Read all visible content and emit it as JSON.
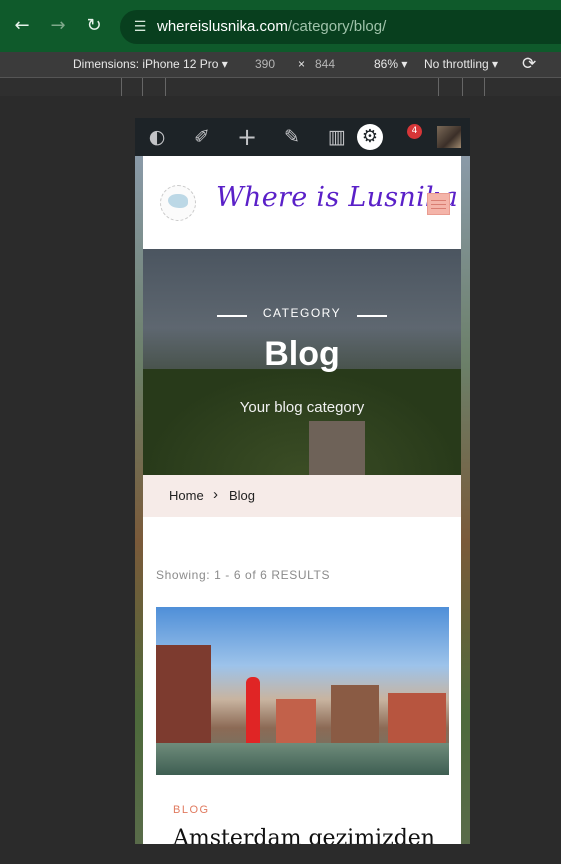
{
  "browser": {
    "url_domain": "whereislusnika.com",
    "url_path": "/category/blog/",
    "back_icon": "arrow-left-icon",
    "forward_icon": "arrow-right-icon",
    "reload_icon": "reload-icon",
    "site_settings_icon": "tune-icon"
  },
  "devtools": {
    "dimensions_label": "Dimensions: iPhone 12 Pro",
    "width": "390",
    "times": "×",
    "height": "844",
    "zoom": "86%",
    "throttling": "No throttling",
    "rotate_icon": "rotate-icon"
  },
  "admin_bar": {
    "icons": [
      "dashboard-icon",
      "customize-icon",
      "add-new-icon",
      "edit-icon",
      "stats-icon",
      "settings-icon",
      "avatar"
    ],
    "notification_count": "4"
  },
  "site": {
    "title": "Where is Lusnika",
    "menu_icon": "hamburger-menu-icon"
  },
  "hero": {
    "kicker": "CATEGORY",
    "title": "Blog",
    "subtitle": "Your blog category"
  },
  "breadcrumb": {
    "home": "Home",
    "separator": "›",
    "current": "Blog"
  },
  "results_text": "Showing: 1 - 6 of 6 RESULTS",
  "post": {
    "category": "BLOG",
    "title": "Amsterdam gezimizden"
  }
}
